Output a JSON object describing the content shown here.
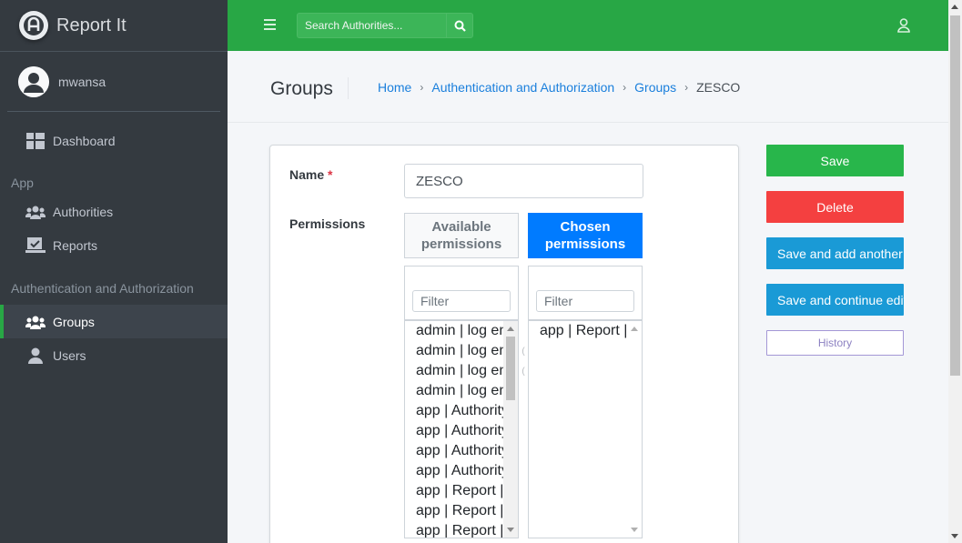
{
  "brand": {
    "name": "Report It"
  },
  "user": {
    "name": "mwansa"
  },
  "sidebar": {
    "dashboard": "Dashboard",
    "app_header": "App",
    "authorities": "Authorities",
    "reports": "Reports",
    "auth_header": "Authentication and Authorization",
    "groups": "Groups",
    "users": "Users"
  },
  "topbar": {
    "search_placeholder": "Search Authorities..."
  },
  "header": {
    "title": "Groups",
    "breadcrumb": [
      "Home",
      "Authentication and Authorization",
      "Groups",
      "ZESCO"
    ]
  },
  "form": {
    "name_label": "Name",
    "required_mark": "*",
    "name_value": "ZESCO",
    "permissions_label": "Permissions",
    "available_title": "Available permissions",
    "chosen_title": "Chosen permissions",
    "filter_placeholder": "Filter",
    "available_options": [
      "admin | log entry",
      "admin | log entry",
      "admin | log entry",
      "admin | log entry",
      "app | Authority",
      "app | Authority",
      "app | Authority",
      "app | Authority",
      "app | Report |",
      "app | Report |",
      "app | Report |"
    ],
    "chosen_options": [
      "app | Report |"
    ]
  },
  "actions": {
    "save": "Save",
    "delete": "Delete",
    "save_add": "Save and add another",
    "save_continue": "Save and continue editing",
    "history": "History"
  },
  "colors": {
    "primary_green": "#28a745",
    "sidebar": "#343a40",
    "chosen_blue": "#007bff",
    "delete_red": "#f44040",
    "info_blue": "#1a9ad6"
  }
}
